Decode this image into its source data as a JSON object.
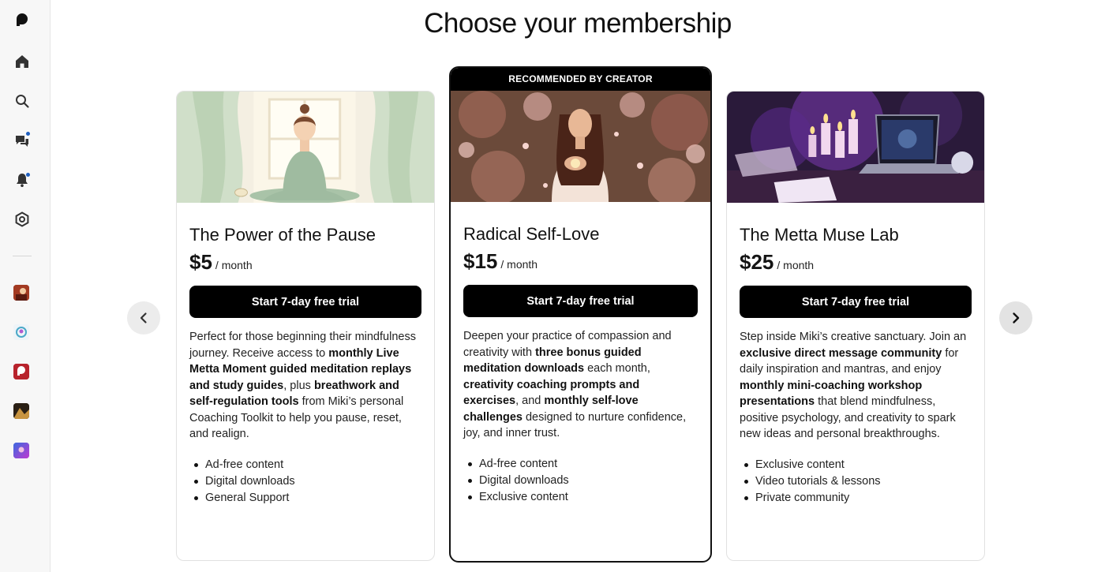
{
  "page": {
    "title": "Choose your membership"
  },
  "sidebar": {
    "icons": [
      "patreon-logo-icon",
      "home-icon",
      "search-icon",
      "chat-icon",
      "bell-icon",
      "settings-icon"
    ],
    "notification_color": "#1f5fbf"
  },
  "carousel": {
    "prev_icon": "chevron-left-icon",
    "next_icon": "chevron-right-icon"
  },
  "tiers": [
    {
      "title": "The Power of the Pause",
      "price": "$5",
      "period": "/ month",
      "cta": "Start 7-day free trial",
      "desc": [
        {
          "t": "Perfect for those beginning their mindfulness journey. Receive access to "
        },
        {
          "t": "monthly Live Metta Moment guided meditation replays and study guides",
          "b": true
        },
        {
          "t": ", plus "
        },
        {
          "t": "breathwork and self-regulation tools",
          "b": true
        },
        {
          "t": " from Miki’s personal Coaching Toolkit to help you pause, reset, and realign."
        }
      ],
      "benefits": [
        "Ad-free content",
        "Digital downloads",
        "General Support"
      ]
    },
    {
      "banner": "RECOMMENDED BY CREATOR",
      "title": "Radical Self-Love",
      "price": "$15",
      "period": "/ month",
      "cta": "Start 7-day free trial",
      "desc": [
        {
          "t": "Deepen your practice of compassion and creativity with "
        },
        {
          "t": "three bonus guided meditation downloads",
          "b": true
        },
        {
          "t": " each month, "
        },
        {
          "t": "creativity coaching prompts and exercises",
          "b": true
        },
        {
          "t": ", and "
        },
        {
          "t": "monthly self-love challenges",
          "b": true
        },
        {
          "t": " designed to nurture confidence, joy, and inner trust."
        }
      ],
      "benefits": [
        "Ad-free content",
        "Digital downloads",
        "Exclusive content"
      ]
    },
    {
      "title": "The Metta Muse Lab",
      "price": "$25",
      "period": "/ month",
      "cta": "Start 7-day free trial",
      "desc": [
        {
          "t": "Step inside Miki’s creative sanctuary. Join an "
        },
        {
          "t": "exclusive direct message community",
          "b": true
        },
        {
          "t": " for daily inspiration and mantras, and enjoy "
        },
        {
          "t": "monthly mini-coaching workshop presentations",
          "b": true
        },
        {
          "t": " that blend mindfulness, positive psychology, and creativity to spark new ideas and personal breakthroughs."
        }
      ],
      "benefits": [
        "Exclusive content",
        "Video tutorials & lessons",
        "Private community"
      ]
    }
  ]
}
